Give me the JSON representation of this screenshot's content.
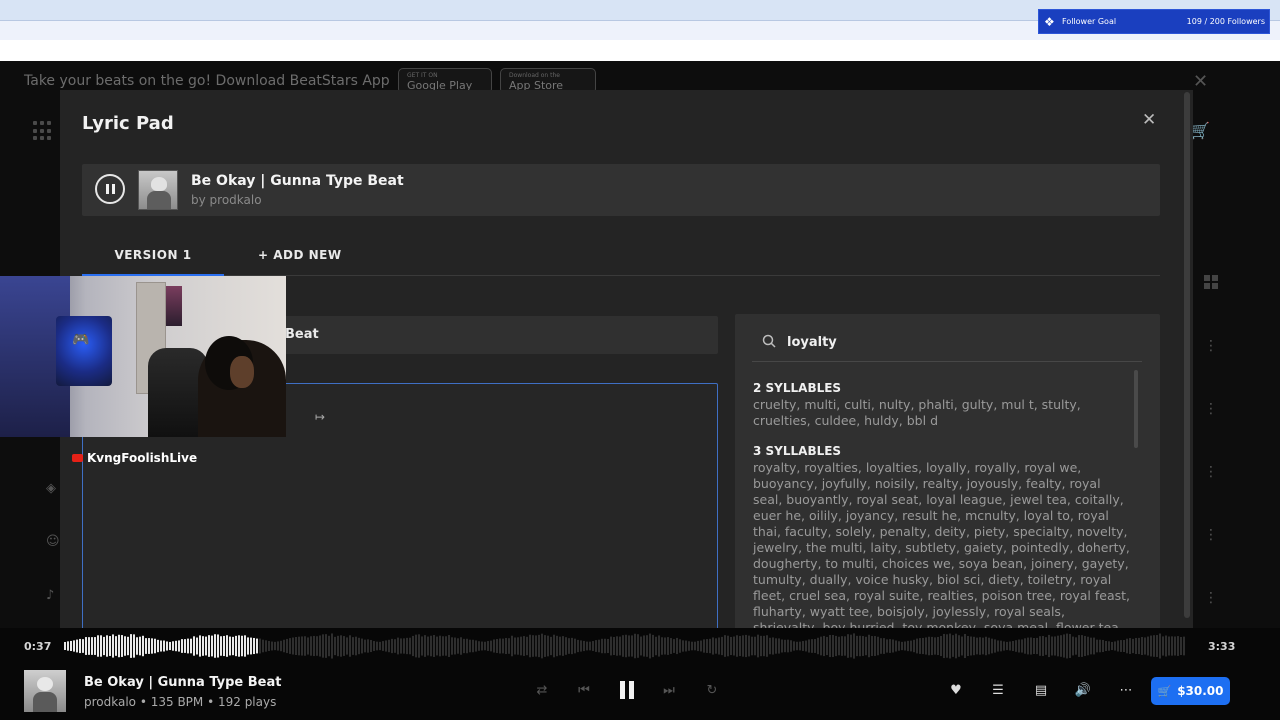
{
  "overlay": {
    "follower_goal": {
      "label": "Follower Goal",
      "count": "109 / 200 Followers"
    },
    "webcam_label": "KvngFoolishLive"
  },
  "background": {
    "app_banner_text": "Take your beats on the go! Download BeatStars App",
    "google_play": {
      "small": "GET IT ON",
      "big": "Google Play"
    },
    "app_store": {
      "small": "Download on the",
      "big": "App Store"
    }
  },
  "modal": {
    "title": "Lyric Pad",
    "track": {
      "title": "Be Okay | Gunna Type Beat",
      "by": "by prodkalo"
    },
    "tabs": [
      {
        "label": "VERSION 1"
      },
      {
        "label": "+ ADD NEW"
      }
    ],
    "lyric_title_value": "Beat",
    "rhyme": {
      "search_value": "loyalty",
      "groups": [
        {
          "heading": "2 SYLLABLES",
          "words": "cruelty, multi, culti, nulty, phalti, gulty, mul t, stulty, cruelties, culdee, huldy, bbl d"
        },
        {
          "heading": "3 SYLLABLES",
          "words": "royalty, royalties, loyalties, loyally, royally, royal we, buoyancy, joyfully, noisily, realty, joyously, fealty, royal seal, buoyantly, royal seat, loyal league, jewel tea, coitally, euer he, oilily, joyancy, result he, mcnulty, loyal to, royal thai, faculty, solely, penalty, deity, piety, specialty, novelty, jewelry, the multi, laity, subtlety, gaiety, pointedly, doherty, dougherty, to multi, choices we, soya bean, joinery, gayety, tumulty, dually, voice husky, biol sci, diety, toiletry, royal fleet, cruel sea, royal suite, realties, poison tree, royal feast, fluharty, wyatt tee, boisjoly, joylessly, royal seals, shrievalty, boy hurried, toy monkey, soya meal, flower tea, nettle tea"
        }
      ]
    }
  },
  "player": {
    "current_time": "0:37",
    "total_time": "3:33",
    "progress": 0.174,
    "title": "Be Okay | Gunna Type Beat",
    "meta": "prodkalo • 135 BPM • 192 plays",
    "price": "$30.00",
    "accent_color": "#1d6ff2"
  }
}
